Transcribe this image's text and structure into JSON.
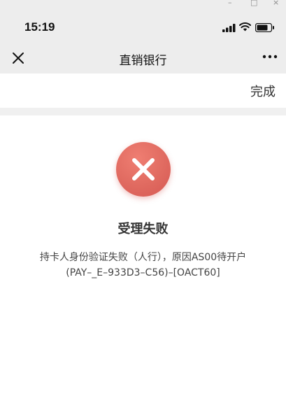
{
  "window": {
    "minimize": "–",
    "maximize": "□",
    "close": "×"
  },
  "status_bar": {
    "time": "15:19"
  },
  "nav": {
    "title": "直销银行"
  },
  "toolbar": {
    "done_label": "完成"
  },
  "result": {
    "title": "受理失败",
    "message_line1": "持卡人身份验证失败（人行），原因AS00待开户",
    "message_line2": "(PAY–_E–933D3–C56)–[OACT60]",
    "icon": "error-x-icon",
    "icon_color": "#e0645d"
  }
}
